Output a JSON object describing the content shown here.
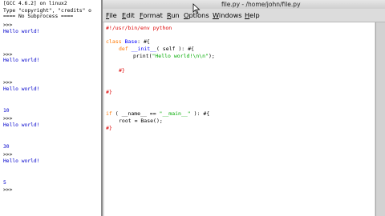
{
  "shell": {
    "lines": [
      "[GCC 4.6.2] on linux2",
      "Type \"copyright\", \"credits\" o",
      "==== No Subprocess ====",
      ">>>",
      "Hello world!",
      ">>>",
      "Hello world!",
      ">>>",
      "Hello world!",
      "10",
      ">>>",
      "Hello world!",
      "30",
      ">>>",
      "Hello world!",
      "5",
      ">>>"
    ]
  },
  "editor": {
    "title": "file.py - /home/john/file.py",
    "menu": [
      {
        "first": "F",
        "rest": "ile"
      },
      {
        "first": "E",
        "rest": "dit"
      },
      {
        "first": "F",
        "rest": "ormat"
      },
      {
        "first": "R",
        "rest": "un"
      },
      {
        "first": "O",
        "rest": "ptions"
      },
      {
        "first": "W",
        "rest": "indows"
      },
      {
        "first": "H",
        "rest": "elp"
      }
    ],
    "code": {
      "shebang": "#!/usr/bin/env python",
      "l1_kw": "class",
      "l1_name": "Base",
      "l1_rest": ": #{",
      "l2_kw": "def",
      "l2_name": "__init__",
      "l2_rest": "( self ): #{",
      "l3_pre": "print(",
      "l3_str": "\"Hello world!\\n\\n\"",
      "l3_post": ");",
      "l4": "#}",
      "l5": "#}",
      "l6_kw": "if",
      "l6_a": "( __name__ == ",
      "l6_str": "\"__main__\"",
      "l6_b": " ): #{",
      "l7": "root = Base();",
      "l8": "#}"
    }
  },
  "colors": {
    "keyword": "#ff7700",
    "definition": "#0000ff",
    "string": "#00aa00",
    "comment": "#dd0000",
    "shell_output": "#0000cc"
  }
}
